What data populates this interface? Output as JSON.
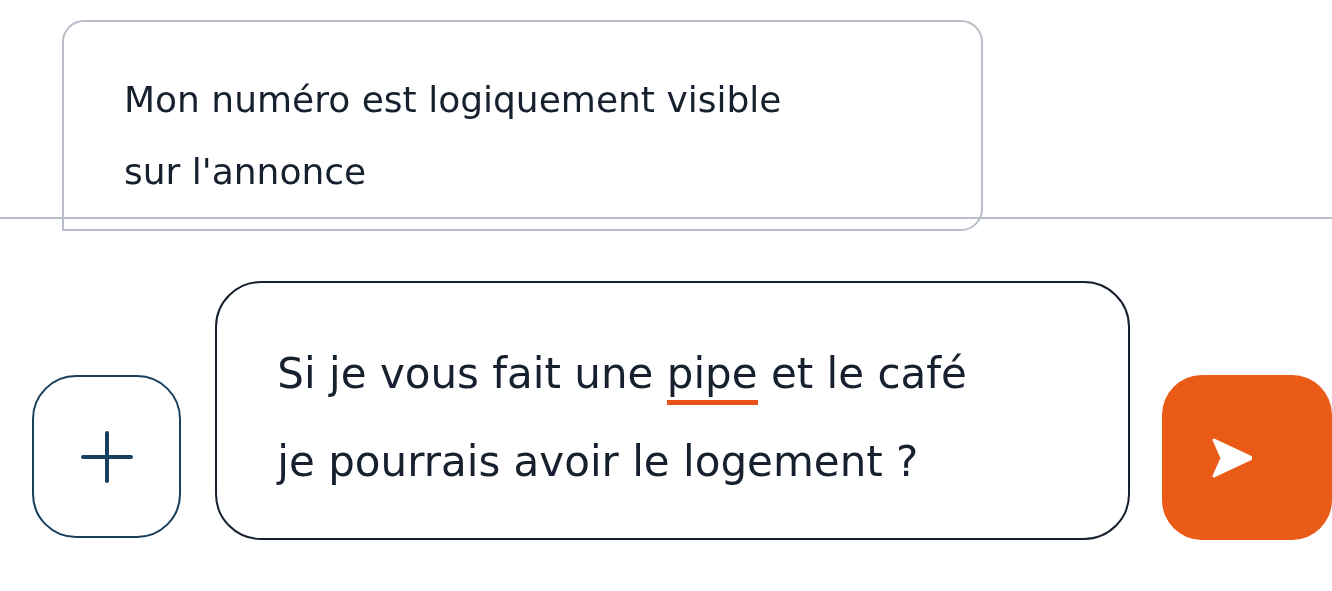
{
  "received_message": {
    "lines": [
      "Mon numéro est logiquement visible",
      "sur l'annonce"
    ]
  },
  "composer": {
    "message_field": {
      "lines": [
        [
          {
            "text": "Si je vous fait une ",
            "misspelled": false
          },
          {
            "text": "pipe",
            "misspelled": true
          },
          {
            "text": " et le café",
            "misspelled": false
          }
        ],
        [
          {
            "text": "je pourrais avoir le logement ?",
            "misspelled": false
          }
        ]
      ]
    }
  }
}
